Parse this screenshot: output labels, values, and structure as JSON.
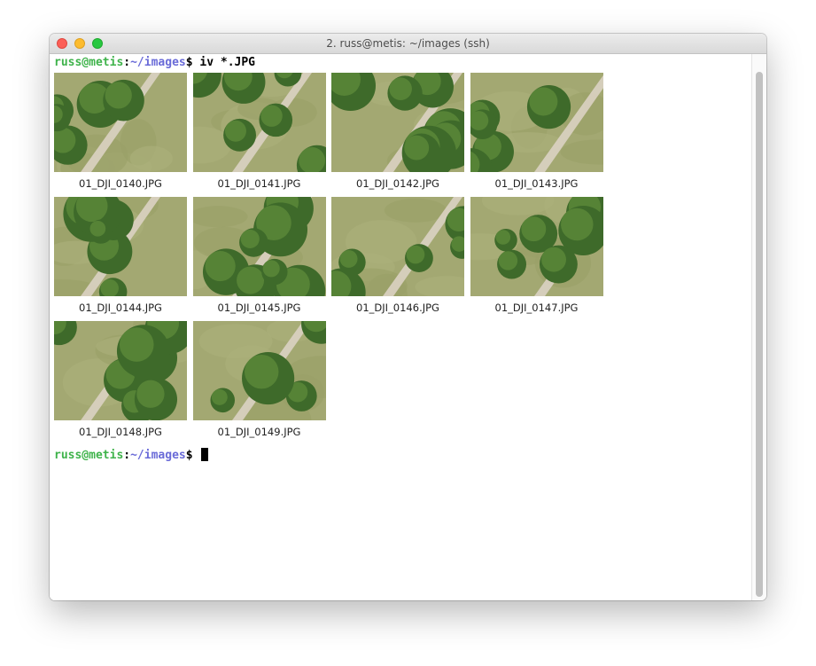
{
  "window": {
    "title": "2. russ@metis: ~/images (ssh)"
  },
  "prompt1": {
    "user": "russ@metis",
    "colon": ":",
    "path": "~/images",
    "dollar": "$",
    "command": " iv *.JPG"
  },
  "prompt2": {
    "user": "russ@metis",
    "colon": ":",
    "path": "~/images",
    "dollar": "$ "
  },
  "images": [
    {
      "name": "01_DJI_0140.JPG",
      "variant": 0
    },
    {
      "name": "01_DJI_0141.JPG",
      "variant": 1
    },
    {
      "name": "01_DJI_0142.JPG",
      "variant": 2
    },
    {
      "name": "01_DJI_0143.JPG",
      "variant": 3
    },
    {
      "name": "01_DJI_0144.JPG",
      "variant": 4
    },
    {
      "name": "01_DJI_0145.JPG",
      "variant": 5
    },
    {
      "name": "01_DJI_0146.JPG",
      "variant": 6
    },
    {
      "name": "01_DJI_0147.JPG",
      "variant": 7
    },
    {
      "name": "01_DJI_0148.JPG",
      "variant": 8
    },
    {
      "name": "01_DJI_0149.JPG",
      "variant": 9
    }
  ],
  "colors": {
    "prompt_user": "#3fb34b",
    "prompt_path": "#6a6bd8",
    "grass": "#a3a872",
    "tree_dark": "#3e6a2a",
    "tree_light": "#5d8a3a",
    "path": "#d8d0bf"
  }
}
